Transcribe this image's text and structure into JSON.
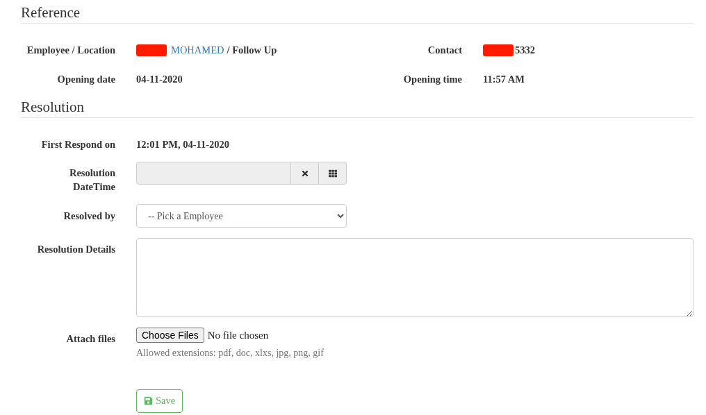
{
  "reference": {
    "heading": "Reference",
    "fields": [
      {
        "kind": "link",
        "label": "Employee / Location",
        "link": "MOHAMED",
        "suffix": "/ Follow Up",
        "redacted": true
      },
      {
        "kind": "text",
        "label": "Contact",
        "value": "5332",
        "redacted": true
      },
      {
        "kind": "text",
        "label": "Opening date",
        "value": "04-11-2020",
        "redacted": false
      },
      {
        "kind": "text",
        "label": "Opening time",
        "value": "11:57 AM",
        "redacted": false
      }
    ]
  },
  "resolution": {
    "heading": "Resolution",
    "fields": [
      {
        "kind": "text",
        "label": "First Respond on",
        "value": "12:01 PM, 04-11-2020"
      },
      {
        "kind": "datetime",
        "label": "Resolution DateTime",
        "disabled": true
      },
      {
        "kind": "select",
        "label": "Resolved by",
        "value": "-- Pick a Employee"
      },
      {
        "kind": "textarea",
        "label": "Resolution Details"
      },
      {
        "kind": "file",
        "label": "Attach files",
        "button": "Choose Files",
        "status": "No file chosen",
        "help": "Allowed extensions: pdf, doc, xlxs, jpg, png, gif"
      }
    ],
    "save": {
      "label": "Save"
    }
  }
}
